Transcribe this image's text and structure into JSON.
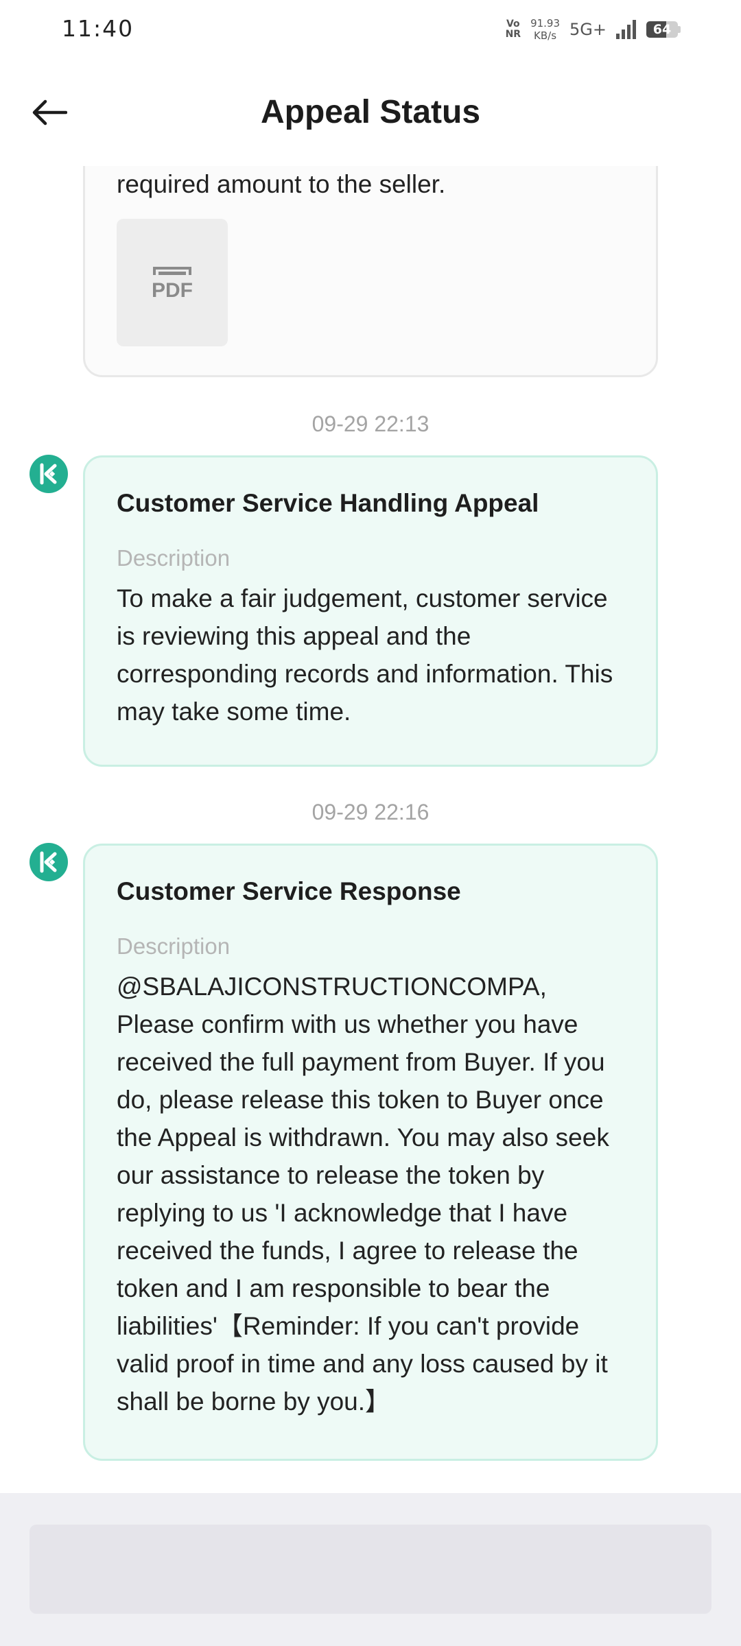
{
  "status_bar": {
    "time": "11:40",
    "vonr_top": "Vo",
    "vonr_bottom": "NR",
    "net_speed_value": "91.93",
    "net_speed_unit": "KB/s",
    "network": "5G+",
    "battery_percent": 64,
    "battery_label": "64"
  },
  "header": {
    "title": "Appeal Status",
    "back_icon": "arrow-left-icon"
  },
  "previous_card": {
    "text": "required amount to the seller.",
    "attachment_icon": "pdf-icon",
    "attachment_label": "PDF"
  },
  "events": [
    {
      "timestamp": "09-29 22:13",
      "avatar_icon": "kucoin-logo-icon",
      "title": "Customer Service Handling Appeal",
      "description_label": "Description",
      "description": "To make a fair judgement, customer service is reviewing this appeal and the corresponding records and information. This may take some time."
    },
    {
      "timestamp": "09-29 22:16",
      "avatar_icon": "kucoin-logo-icon",
      "title": "Customer Service Response",
      "description_label": "Description",
      "description": "@SBALAJICONSTRUCTIONCOMPA, Please confirm with us whether you have received the full payment from Buyer. If you do, please release this token to Buyer once the Appeal is withdrawn. You may also seek our assistance to release the token by replying to us 'I acknowledge that I have received the funds, I agree to release the token and I am responsible to bear the liabilities'【Reminder: If you can't provide valid proof in time and any loss caused by it shall be borne by you.】"
    }
  ],
  "colors": {
    "accent": "#23af91",
    "card_background": "#eefaf6",
    "card_border": "#c9efe3",
    "timestamp": "#a4a4a4"
  }
}
